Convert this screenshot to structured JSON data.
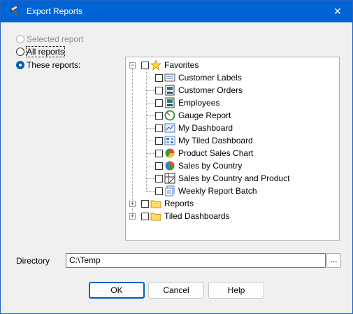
{
  "window": {
    "title": "Export Reports",
    "icon": "tools-hammer-icon",
    "close_glyph": "✕"
  },
  "options": {
    "selected_report": "Selected report",
    "all_reports": "All reports",
    "these_reports": "These reports:"
  },
  "tree": {
    "favorites": "Favorites",
    "items": [
      {
        "label": "Customer Labels",
        "icon": "labels-report-icon"
      },
      {
        "label": "Customer Orders",
        "icon": "report-icon"
      },
      {
        "label": "Employees",
        "icon": "report-icon"
      },
      {
        "label": "Gauge Report",
        "icon": "gauge-icon"
      },
      {
        "label": "My Dashboard",
        "icon": "dashboard-icon"
      },
      {
        "label": "My Tiled Dashboard",
        "icon": "tiled-dashboard-icon"
      },
      {
        "label": "Product Sales Chart",
        "icon": "pie-chart-icon"
      },
      {
        "label": "Sales by Country",
        "icon": "pie-chart-icon"
      },
      {
        "label": "Sales by Country and Product",
        "icon": "crosstab-icon"
      },
      {
        "label": "Weekly Report Batch",
        "icon": "batch-icon"
      }
    ],
    "reports": "Reports",
    "tiled_dashboards": "Tiled Dashboards"
  },
  "directory": {
    "label": "Directory",
    "value": "C:\\Temp",
    "browse": "..."
  },
  "buttons": {
    "ok": "OK",
    "cancel": "Cancel",
    "help": "Help"
  }
}
